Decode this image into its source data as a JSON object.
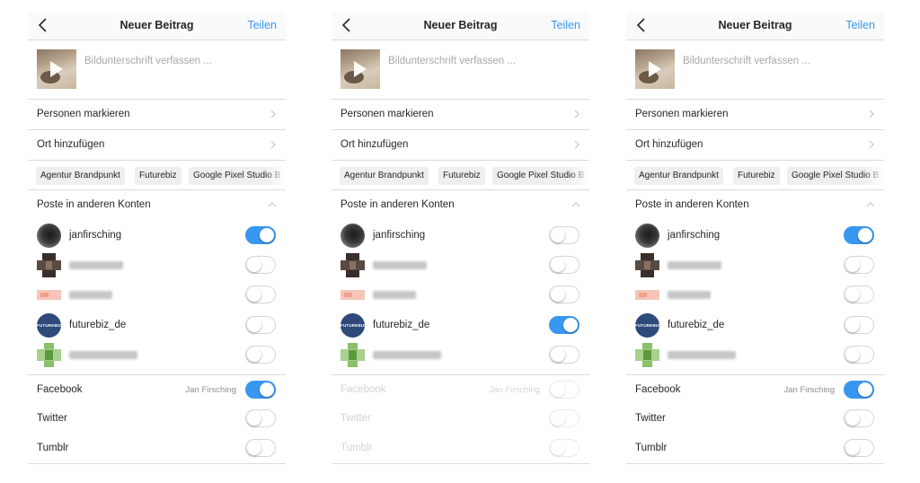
{
  "nav": {
    "title": "Neuer Beitrag",
    "share_label": "Teilen"
  },
  "caption": {
    "placeholder": "Bildunterschrift verfassen ..."
  },
  "rows": {
    "tag_people": "Personen markieren",
    "add_location": "Ort hinzufügen"
  },
  "location_suggestions": [
    "Agentur Brandpunkt",
    "Futurebiz",
    "Google Pixel Studio B"
  ],
  "section": {
    "other_accounts": "Poste in anderen Konten"
  },
  "accounts": {
    "janfirsching": "janfirsching",
    "futurebiz": "futurebiz_de",
    "futurebiz_avatar_text": "FUTUREBIZ"
  },
  "social": {
    "facebook": "Facebook",
    "facebook_account": "Jan Firsching",
    "twitter": "Twitter",
    "tumblr": "Tumblr"
  },
  "colors": {
    "accent": "#3897f0",
    "divider": "#dbdbdb",
    "placeholder": "#a8a8a8"
  },
  "icons": [
    "back-chevron-icon",
    "chevron-right-icon",
    "chevron-up-icon",
    "play-icon"
  ],
  "screens": [
    {
      "toggles": {
        "janfirsching": true,
        "account_2": false,
        "account_3": false,
        "futurebiz": false,
        "account_5": false,
        "facebook": true,
        "twitter": false,
        "tumblr": false
      },
      "social_disabled": false
    },
    {
      "toggles": {
        "janfirsching": false,
        "account_2": false,
        "account_3": false,
        "futurebiz": true,
        "account_5": false,
        "facebook": false,
        "twitter": false,
        "tumblr": false
      },
      "social_disabled": true
    },
    {
      "toggles": {
        "janfirsching": true,
        "account_2": false,
        "account_3": false,
        "futurebiz": false,
        "account_5": false,
        "facebook": true,
        "twitter": false,
        "tumblr": false
      },
      "social_disabled": false
    }
  ]
}
